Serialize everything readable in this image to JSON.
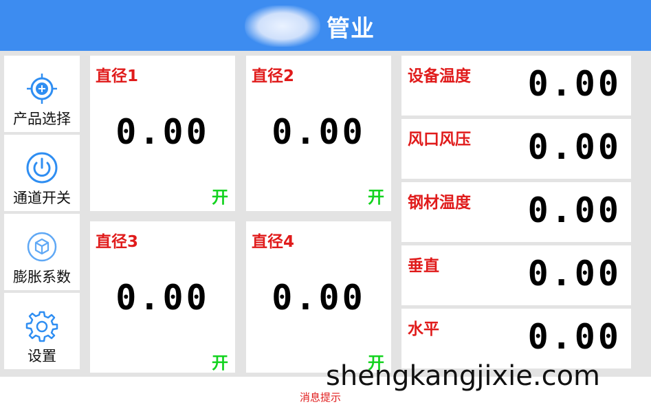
{
  "header": {
    "title": "管业",
    "logo_icon": "blurred-logo-icon",
    "background": "#3d8cf0"
  },
  "nav": [
    {
      "label": "产品选择",
      "icon": "crosshair-icon"
    },
    {
      "label": "通道开关",
      "icon": "power-icon"
    },
    {
      "label": "膨胀系数",
      "icon": "cube-icon"
    },
    {
      "label": "设置",
      "icon": "gear-icon"
    }
  ],
  "diameters": [
    {
      "label": "直径1",
      "value": "0.00",
      "state": "开"
    },
    {
      "label": "直径2",
      "value": "0.00",
      "state": "开"
    },
    {
      "label": "直径3",
      "value": "0.00",
      "state": "开"
    },
    {
      "label": "直径4",
      "value": "0.00",
      "state": "开"
    }
  ],
  "params": [
    {
      "label": "设备温度",
      "value": "0.00"
    },
    {
      "label": "风口风压",
      "value": "0.00"
    },
    {
      "label": "钢材温度",
      "value": "0.00"
    },
    {
      "label": "垂直",
      "value": "0.00"
    },
    {
      "label": "水平",
      "value": "0.00"
    }
  ],
  "status": {
    "message": "消息提示"
  },
  "watermark": "shengkangjixie.com",
  "colors": {
    "accent": "#3d8cf0",
    "label_red": "#e01b1b",
    "state_green": "#13d31f",
    "icon_blue": "#2f8ef2"
  }
}
